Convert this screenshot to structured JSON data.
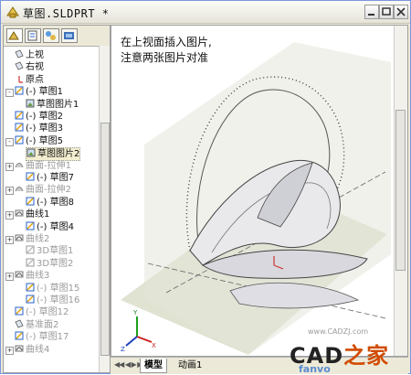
{
  "window": {
    "title": "草图.SLDPRT *",
    "buttons": [
      "minimize",
      "maximize",
      "close"
    ]
  },
  "panel_tabs": [
    "feature-manager-icon",
    "property-manager-icon",
    "configuration-manager-icon",
    "dimxpert-icon"
  ],
  "tree": [
    {
      "label": "上视",
      "icon": "plane-icon",
      "indent": 1,
      "grey": false
    },
    {
      "label": "右视",
      "icon": "plane-icon",
      "indent": 1,
      "grey": false
    },
    {
      "label": "原点",
      "icon": "origin-icon",
      "indent": 1,
      "grey": false
    },
    {
      "label": "(-) 草图1",
      "icon": "sketch-icon",
      "indent": 1,
      "grey": false,
      "expander": "-"
    },
    {
      "label": "草图图片1",
      "icon": "picture-icon",
      "indent": 2,
      "grey": false
    },
    {
      "label": "(-) 草图2",
      "icon": "sketch-icon",
      "indent": 1,
      "grey": false
    },
    {
      "label": "(-) 草图3",
      "icon": "sketch-icon",
      "indent": 1,
      "grey": false
    },
    {
      "label": "(-) 草图5",
      "icon": "sketch-icon",
      "indent": 1,
      "grey": false,
      "expander": "-"
    },
    {
      "label": "草图图片2",
      "icon": "picture-icon",
      "indent": 2,
      "grey": false,
      "highlight": true
    },
    {
      "label": "曲面-拉伸1",
      "icon": "surface-icon",
      "indent": 1,
      "grey": true,
      "expander": "+"
    },
    {
      "label": "(-) 草图7",
      "icon": "sketch-icon",
      "indent": 2,
      "grey": false
    },
    {
      "label": "曲面-拉伸2",
      "icon": "surface-icon",
      "indent": 1,
      "grey": true,
      "expander": "+"
    },
    {
      "label": "(-) 草图8",
      "icon": "sketch-icon",
      "indent": 2,
      "grey": false
    },
    {
      "label": "曲线1",
      "icon": "curve-icon",
      "indent": 1,
      "grey": false,
      "expander": "+"
    },
    {
      "label": "(-) 草图4",
      "icon": "sketch-icon",
      "indent": 2,
      "grey": false
    },
    {
      "label": "曲线2",
      "icon": "curve-icon",
      "indent": 1,
      "grey": true,
      "expander": "+"
    },
    {
      "label": "3D草图1",
      "icon": "sketch3d-icon",
      "indent": 2,
      "grey": true
    },
    {
      "label": "3D草图2",
      "icon": "sketch3d-icon",
      "indent": 2,
      "grey": true
    },
    {
      "label": "曲线3",
      "icon": "curve-icon",
      "indent": 1,
      "grey": true,
      "expander": "+"
    },
    {
      "label": "(-) 草图15",
      "icon": "sketch-icon",
      "indent": 2,
      "grey": true
    },
    {
      "label": "(-) 草图16",
      "icon": "sketch-icon",
      "indent": 2,
      "grey": true
    },
    {
      "label": "(-) 草图12",
      "icon": "sketch-icon",
      "indent": 1,
      "grey": true
    },
    {
      "label": "基准面2",
      "icon": "plane-icon",
      "indent": 1,
      "grey": true
    },
    {
      "label": "(-) 草图17",
      "icon": "sketch-icon",
      "indent": 1,
      "grey": true
    },
    {
      "label": "曲线4",
      "icon": "curve-icon",
      "indent": 1,
      "grey": true,
      "expander": "+"
    }
  ],
  "viewport": {
    "note_line1": "在上视面插入图片,",
    "note_line2": "注意两张图片对准"
  },
  "bottom_tabs": {
    "model": "模型",
    "motion": "动画1"
  },
  "watermark": {
    "brand_a": "CAD",
    "brand_b": "之家",
    "url": "www.CADZJ.com",
    "sub": "fanvo"
  },
  "colors": {
    "accent": "#ece9d8",
    "sketch_blue": "#2255cc",
    "sketch_yellow": "#e0b000",
    "plane_fill": "#d5d9c2"
  }
}
